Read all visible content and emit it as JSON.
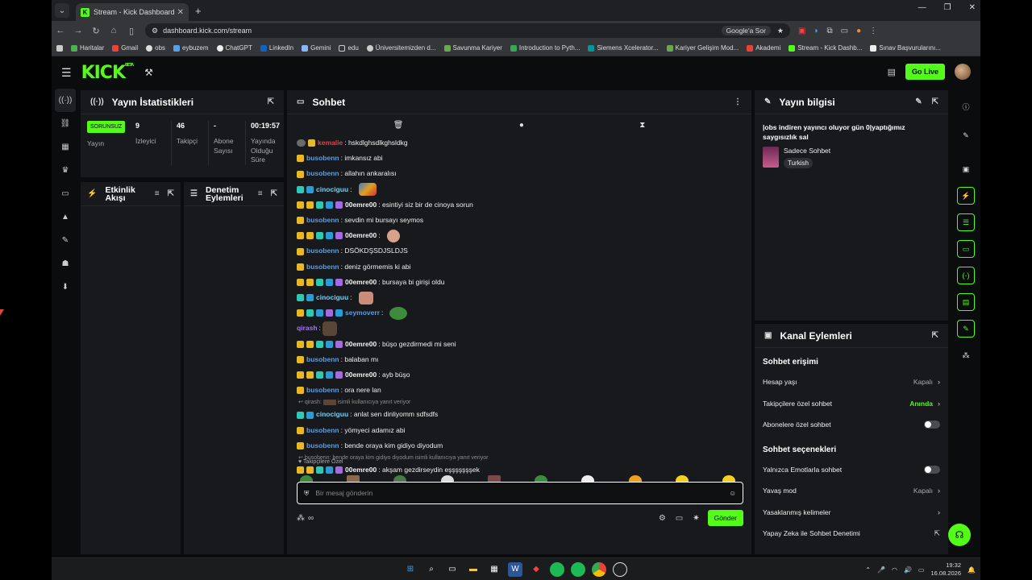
{
  "browser": {
    "tab_title": "Stream - Kick Dashboard",
    "url": "dashboard.kick.com/stream",
    "google_lens_label": "Google'a Sor",
    "bookmarks": [
      "Haritalar",
      "Gmail",
      "obs",
      "eybuzem",
      "ChatGPT",
      "LinkedIn",
      "Gemini",
      "edu",
      "Üniversitemizden d...",
      "Savunma Kariyer",
      "Introduction to Pyth...",
      "Siemens Xcelerator...",
      "Kariyer Gelişim Mod...",
      "Akademi",
      "Stream - Kick Dashb...",
      "Sınav Başvurularını..."
    ]
  },
  "header": {
    "logo": "KICK",
    "logo_beta": "BETA",
    "go_live": "Go Live"
  },
  "stats_panel": {
    "title": "Yayın İstatistikleri",
    "status_badge": "SORUNSUZ",
    "status_label": "Yayın",
    "viewers_value": "9",
    "viewers_label": "İzleyici",
    "followers_value": "46",
    "followers_label": "Takipçi",
    "subs_value": "-",
    "subs_label": "Abone Sayısı",
    "uptime_value": "00:19:57",
    "uptime_label": "Yayında Olduğu Süre"
  },
  "activity_panel": {
    "title": "Etkinlik Akışı"
  },
  "moderation_panel": {
    "title": "Denetim Eylemleri"
  },
  "chat": {
    "title": "Sohbet",
    "messages": [
      {
        "user": "kemalie",
        "text": "hskdlghsdlkghsldkg"
      },
      {
        "user": "busobenn",
        "text": "imkansız abi"
      },
      {
        "user": "busobenn",
        "text": "allahın ankaralısı"
      },
      {
        "user": "cinociguu",
        "text": ""
      },
      {
        "user": "00emre00",
        "text": "esintiyi siz bir de cinoya sorun"
      },
      {
        "user": "busobenn",
        "text": "sevdin mi bursayı seymos"
      },
      {
        "user": "00emre00",
        "text": ""
      },
      {
        "user": "busobenn",
        "text": "DSÖKDŞSDJSLDJS"
      },
      {
        "user": "busobenn",
        "text": "deniz görmemis ki abi"
      },
      {
        "user": "00emre00",
        "text": "bursaya bi girişi oldu"
      },
      {
        "user": "cinociguu",
        "text": ""
      },
      {
        "user": "seymoverr",
        "text": ""
      },
      {
        "user": "qirash",
        "text": ""
      },
      {
        "user": "00emre00",
        "text": "büşo gezdirmedi mi seni"
      },
      {
        "user": "busobenn",
        "text": "balaban mı"
      },
      {
        "user": "00emre00",
        "text": "ayb büşo"
      },
      {
        "user": "busobenn",
        "text": "ora nere lan"
      },
      {
        "user": "cinociguu",
        "text": "anlat sen dinliyomm sdfsdfs"
      },
      {
        "user": "busobenn",
        "text": "yömyeci adamız abi"
      },
      {
        "user": "busobenn",
        "text": "bende oraya kim gidiyo diyodum"
      },
      {
        "user": "00emre00",
        "text": "akşam gezdirseydin eşşşşşşşek"
      }
    ],
    "reply_1_user": "qirash:",
    "reply_1_text": "isimli kullanıcıya yanıt veriyor",
    "reply_2_text": "busobenn: bende oraya kim gidiyo diyodum isimli kullanıcıya yanıt veriyor",
    "followers_only_label": "Takipçilere Özel",
    "input_placeholder": "Bir mesaj gönderin",
    "send_label": "Gönder"
  },
  "stream_info": {
    "title": "Yayın bilgisi",
    "stream_title": "|obs indiren yayıncı oluyor gün 0|yaptığımız saygısızlık sal",
    "category": "Sadece Sohbet",
    "language": "Turkish"
  },
  "channel_actions": {
    "title": "Kanal Eylemleri",
    "chat_access_heading": "Sohbet erişimi",
    "account_age_label": "Hesap yaşı",
    "account_age_value": "Kapalı",
    "followers_only_label": "Takipçilere özel sohbet",
    "followers_only_value": "Anında",
    "subscribers_only_label": "Abonelere özel sohbet",
    "chat_options_heading": "Sohbet seçenekleri",
    "emote_only_label": "Yalnızca Emotlarla sohbet",
    "slow_mode_label": "Yavaş mod",
    "slow_mode_value": "Kapalı",
    "banned_words_label": "Yasaklanmış kelimeler",
    "ai_moderation_label": "Yapay Zeka ile Sohbet Denetimi"
  },
  "taskbar": {
    "time": "19:32",
    "date": "16.08.2026"
  },
  "colors": {
    "accent": "#53fc18",
    "panel": "#18191c",
    "background": "#0b0c0d"
  }
}
